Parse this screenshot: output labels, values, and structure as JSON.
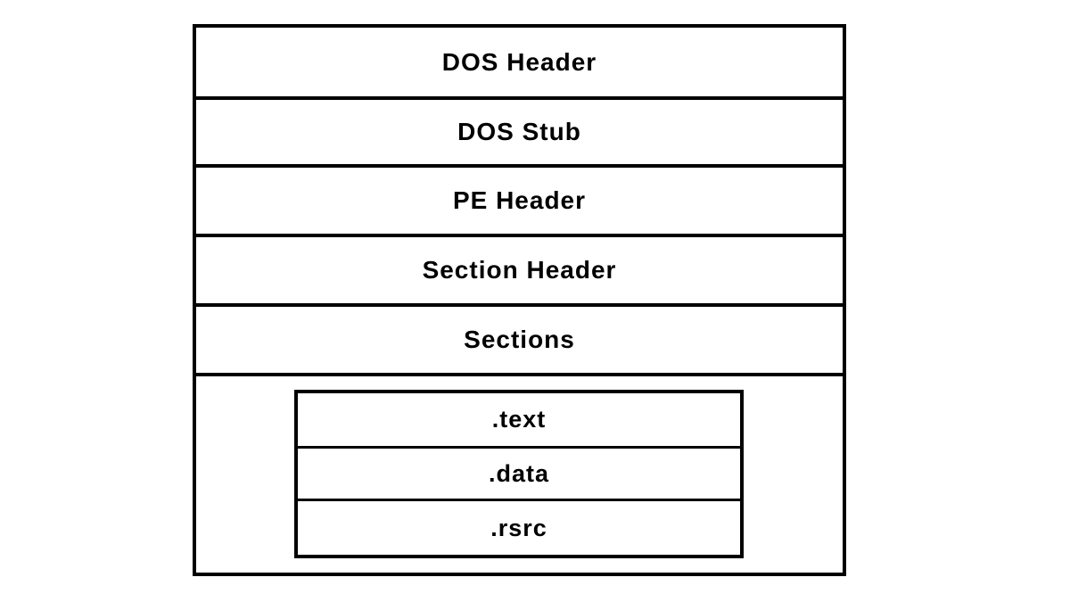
{
  "diagram": {
    "layers": [
      "DOS Header",
      "DOS Stub",
      "PE Header",
      "Section Header",
      "Sections"
    ],
    "section_entries": [
      ".text",
      ".data",
      ".rsrc"
    ]
  }
}
